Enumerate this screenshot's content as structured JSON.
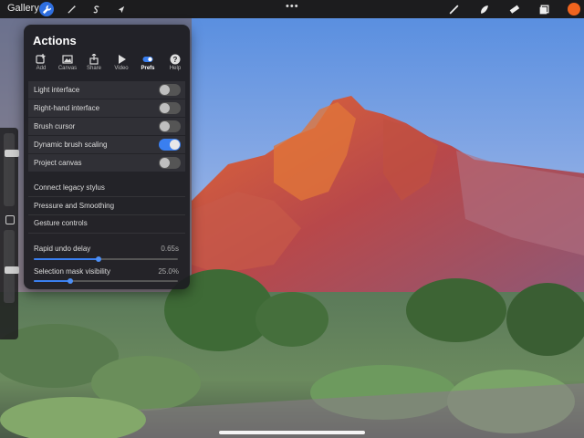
{
  "topbar": {
    "gallery_label": "Gallery",
    "more_label": "•••",
    "accent_color": "#2f6fe0",
    "current_color": "#f0641e"
  },
  "panel": {
    "title": "Actions",
    "tabs": [
      {
        "label": "Add",
        "icon": "add-icon"
      },
      {
        "label": "Canvas",
        "icon": "image-icon"
      },
      {
        "label": "Share",
        "icon": "share-icon"
      },
      {
        "label": "Video",
        "icon": "play-icon"
      },
      {
        "label": "Prefs",
        "icon": "toggle-icon"
      },
      {
        "label": "Help",
        "icon": "help-icon"
      }
    ],
    "active_tab": "Prefs",
    "toggles": [
      {
        "label": "Light interface",
        "on": false
      },
      {
        "label": "Right-hand interface",
        "on": false
      },
      {
        "label": "Brush cursor",
        "on": false
      },
      {
        "label": "Dynamic brush scaling",
        "on": true
      },
      {
        "label": "Project canvas",
        "on": false
      }
    ],
    "links": [
      "Connect legacy stylus",
      "Pressure and Smoothing",
      "Gesture controls"
    ],
    "sliders": [
      {
        "label": "Rapid undo delay",
        "value": "0.65s",
        "fraction": 0.45
      },
      {
        "label": "Selection mask visibility",
        "value": "25.0%",
        "fraction": 0.25
      }
    ]
  },
  "sidebar": {
    "size_level": 0.25,
    "opacity_level": 0.55
  }
}
